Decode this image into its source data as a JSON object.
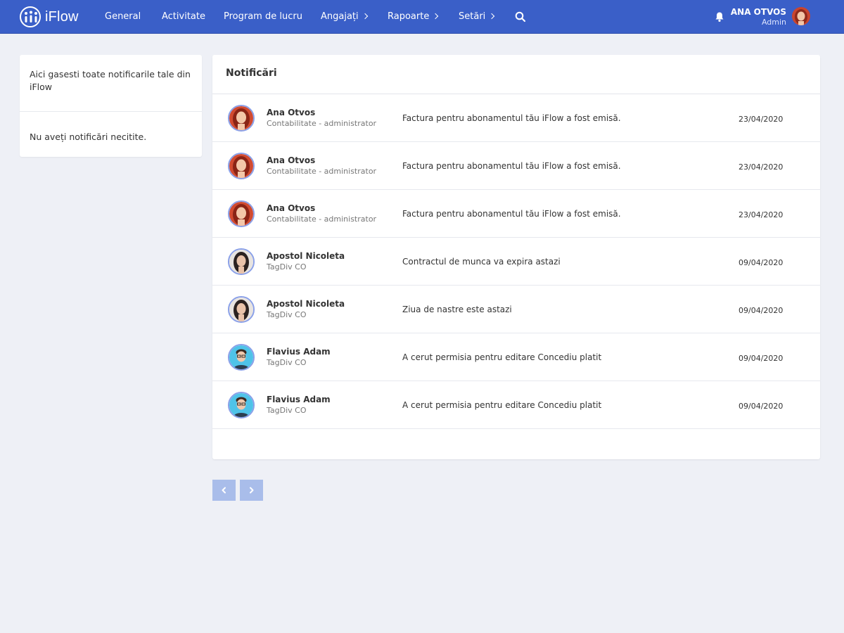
{
  "app": {
    "name": "iFlow"
  },
  "nav": {
    "items": [
      {
        "label": "General",
        "has_submenu": false
      },
      {
        "label": "Activitate",
        "has_submenu": false
      },
      {
        "label": "Program de lucru",
        "has_submenu": false
      },
      {
        "label": "Angajați",
        "has_submenu": true
      },
      {
        "label": "Rapoarte",
        "has_submenu": true
      },
      {
        "label": "Setări",
        "has_submenu": true
      }
    ]
  },
  "user": {
    "name": "ANA OTVOS",
    "role": "Admin"
  },
  "sidebar": {
    "description": "Aici gasesti toate notificarile tale din iFlow",
    "empty_message": "Nu aveți notificări necitite."
  },
  "notifications": {
    "title": "Notificări",
    "items": [
      {
        "name": "Ana Otvos",
        "department": "Contabilitate - administrator",
        "message": "Factura pentru abonamentul tău iFlow a fost emisă.",
        "date": "23/04/2020",
        "avatar": "woman-red-hair"
      },
      {
        "name": "Ana Otvos",
        "department": "Contabilitate - administrator",
        "message": "Factura pentru abonamentul tău iFlow a fost emisă.",
        "date": "23/04/2020",
        "avatar": "woman-red-hair"
      },
      {
        "name": "Ana Otvos",
        "department": "Contabilitate - administrator",
        "message": "Factura pentru abonamentul tău iFlow a fost emisă.",
        "date": "23/04/2020",
        "avatar": "woman-red-hair"
      },
      {
        "name": "Apostol Nicoleta",
        "department": "TagDiv CO",
        "message": "Contractul de munca va expira astazi",
        "date": "09/04/2020",
        "avatar": "woman-dark-hair"
      },
      {
        "name": "Apostol Nicoleta",
        "department": "TagDiv CO",
        "message": "Ziua de nastre este astazi",
        "date": "09/04/2020",
        "avatar": "woman-dark-hair"
      },
      {
        "name": "Flavius Adam",
        "department": "TagDiv CO",
        "message": "A cerut permisia pentru editare Concediu platit",
        "date": "09/04/2020",
        "avatar": "man-glasses"
      },
      {
        "name": "Flavius Adam",
        "department": "TagDiv CO",
        "message": "A cerut permisia pentru editare Concediu platit",
        "date": "09/04/2020",
        "avatar": "man-glasses"
      }
    ]
  },
  "pagination": {
    "prev_icon": "chevron-left-icon",
    "next_icon": "chevron-right-icon"
  },
  "colors": {
    "navbar": "#3a5fc8",
    "background": "#eef0f6",
    "pager": "#a9bdea"
  }
}
